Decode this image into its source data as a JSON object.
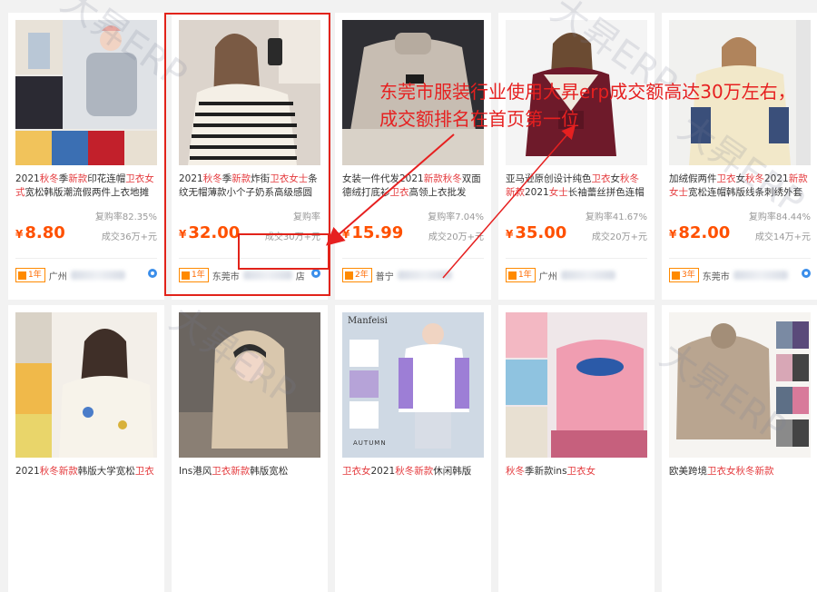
{
  "annotation": "东莞市服装行业使用大昇erp成交额高达30万左右，成交额排名在首页第一位",
  "watermark": "大昇ERP",
  "colors": {
    "price": "#ff5000",
    "highlight": "#e4393c",
    "annotation": "#e62020",
    "badge": "#ff8a00"
  },
  "products": [
    {
      "title_parts": [
        "2021",
        "秋冬",
        "季",
        "新款",
        "印花连帽",
        "卫衣女式",
        "宽松韩版潮流假两件上衣地摊批发"
      ],
      "hl": [
        false,
        true,
        false,
        true,
        false,
        true,
        false
      ],
      "repurchase": "复购率82.35%",
      "currency": "¥",
      "price": "8.80",
      "deal": "成交36万+元",
      "years": "1年",
      "shop_prefix": "广州"
    },
    {
      "title_parts": [
        "2021",
        "秋冬",
        "季",
        "新款",
        "炸街",
        "卫衣女士",
        "条纹无帽薄款小个子奶系高级感圆领潮"
      ],
      "hl": [
        false,
        true,
        false,
        true,
        false,
        true,
        false
      ],
      "repurchase": "复购率",
      "currency": "¥",
      "price": "32.00",
      "deal": "成交30万+元",
      "years": "1年",
      "shop_prefix": "东莞市",
      "shop_suffix": "店"
    },
    {
      "title_parts": [
        "女装一件代发2021",
        "新款秋冬",
        "双面德绒打底衫",
        "",
        "卫衣",
        "高领上衣批发"
      ],
      "hl": [
        false,
        true,
        false,
        false,
        true,
        false
      ],
      "repurchase": "复购率7.04%",
      "currency": "¥",
      "price": "15.99",
      "deal": "成交20万+元",
      "years": "2年",
      "shop_prefix": "普宁"
    },
    {
      "title_parts": [
        "亚马逊原创设计纯色",
        "卫衣",
        "女",
        "秋冬新款",
        "2021",
        "女士",
        "长袖蕾丝拼色连帽",
        "卫衣"
      ],
      "hl": [
        false,
        true,
        false,
        true,
        false,
        true,
        false,
        true
      ],
      "repurchase": "复购率41.67%",
      "currency": "¥",
      "price": "35.00",
      "deal": "成交20万+元",
      "years": "1年",
      "shop_prefix": "广州"
    },
    {
      "title_parts": [
        "加绒假两件",
        "卫衣",
        "女",
        "秋冬",
        "2021",
        "新款女士",
        "宽松连帽韩版线条刺绣外套"
      ],
      "hl": [
        false,
        true,
        false,
        true,
        false,
        true,
        false
      ],
      "repurchase": "复购率84.44%",
      "currency": "¥",
      "price": "82.00",
      "deal": "成交14万+元",
      "years": "3年",
      "shop_prefix": "东莞市"
    }
  ],
  "row2": [
    {
      "title_parts": [
        "2021",
        "秋冬",
        "新款",
        "韩版大学宽松",
        "卫衣"
      ],
      "hl": [
        false,
        true,
        true,
        false,
        true
      ]
    },
    {
      "title_parts": [
        "Ins港风",
        "卫衣",
        "",
        "新款",
        "韩版宽松"
      ],
      "hl": [
        false,
        true,
        false,
        true,
        false
      ]
    },
    {
      "title_parts": [
        "",
        "卫衣女",
        "2021",
        "秋冬新款",
        "休闲韩版"
      ],
      "hl": [
        false,
        true,
        false,
        true,
        false
      ],
      "brand": "Manfeisi",
      "sub": "AUTUMN"
    },
    {
      "title_parts": [
        "",
        "秋冬",
        "季新款",
        "ins",
        "卫衣女"
      ],
      "hl": [
        false,
        true,
        false,
        false,
        true
      ]
    },
    {
      "title_parts": [
        "欧美跨境",
        "卫衣女",
        "",
        "秋冬",
        "新款"
      ],
      "hl": [
        false,
        true,
        false,
        true,
        true
      ]
    }
  ]
}
